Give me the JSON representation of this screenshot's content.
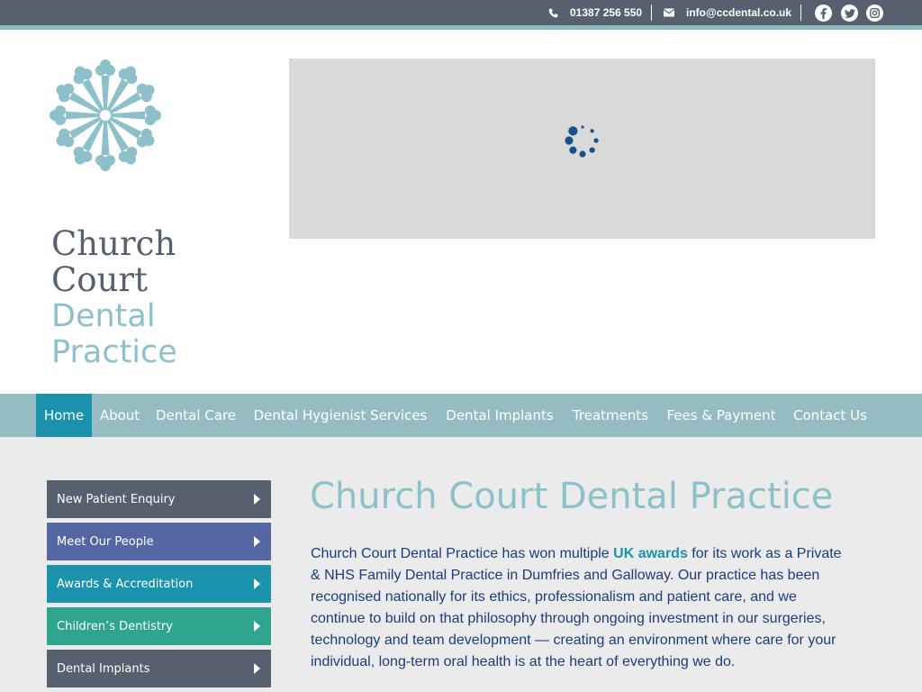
{
  "topbar": {
    "phone": "01387 256 550",
    "email": "info@ccdental.co.uk",
    "social": [
      "facebook-icon",
      "twitter-icon",
      "instagram-icon"
    ]
  },
  "brand": {
    "line1": "Church",
    "line2": "Court",
    "line3": "Dental",
    "line4": "Practice"
  },
  "nav": {
    "items": [
      {
        "label": "Home"
      },
      {
        "label": "About"
      },
      {
        "label": "Dental Care"
      },
      {
        "label": "Dental Hygienist Services"
      },
      {
        "label": "Dental Implants"
      },
      {
        "label": "Treatments"
      },
      {
        "label": "Fees & Payment"
      },
      {
        "label": "Contact Us"
      }
    ],
    "active": "Home"
  },
  "sidebar": {
    "items": [
      {
        "label": "New Patient Enquiry"
      },
      {
        "label": "Meet Our People"
      },
      {
        "label": "Awards & Accreditation"
      },
      {
        "label": "Children’s Dentistry"
      },
      {
        "label": "Dental Implants"
      }
    ]
  },
  "main": {
    "title": "Church Court Dental Practice",
    "intro_before": "Church Court Dental Practice has won multiple ",
    "intro_link": "UK awards",
    "intro_after": " for its work as a Private & NHS Family Dental Practice in Dumfries and Galloway. Our practice has been recognised nationally for its ethics, professionalism and patient care, and we continue to build on that philosophy through ongoing investment in our surgeries, technology and team development — creating an environment where care for your individual, long-term oral health is at the heart of everything we do."
  },
  "colors": {
    "topbar": "#56606f",
    "accent": "#1c93ad",
    "nav": "#96bcc3",
    "brand_light": "#8dc0ca",
    "sidebar": [
      "#56606f",
      "#5467a3",
      "#1c93ad",
      "#2fa58f",
      "#56606f"
    ]
  }
}
